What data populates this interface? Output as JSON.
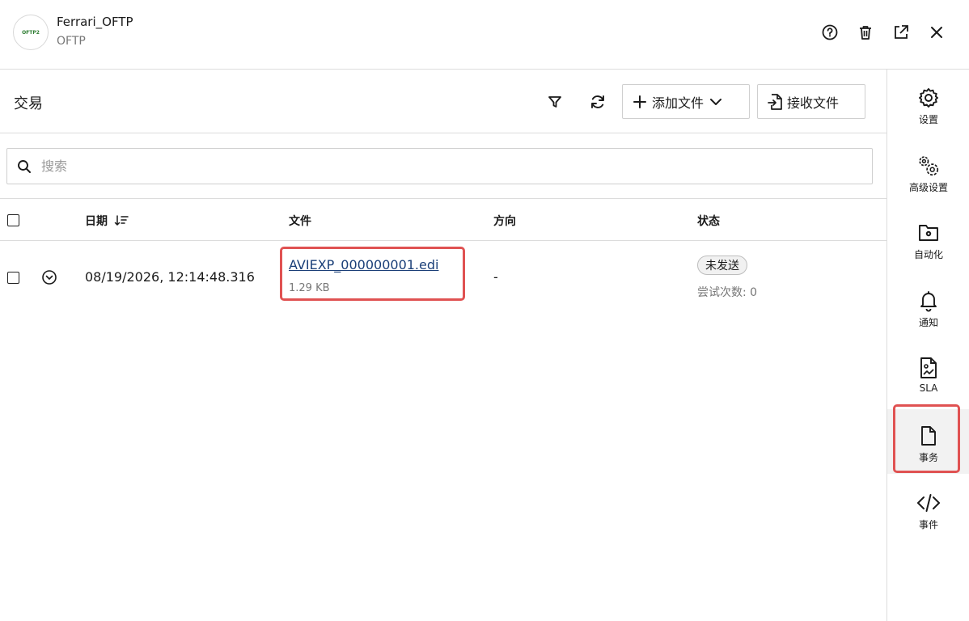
{
  "header": {
    "logo_text": "OFTP2",
    "title": "Ferrari_OFTP",
    "subtitle": "OFTP",
    "icons": [
      "help-icon",
      "trash-icon",
      "external-link-icon",
      "close-icon"
    ]
  },
  "toolbar": {
    "title": "交易",
    "add_file_label": "添加文件",
    "receive_file_label": "接收文件"
  },
  "search": {
    "placeholder": "搜索"
  },
  "table": {
    "columns": {
      "date": "日期",
      "file": "文件",
      "direction": "方向",
      "status": "状态"
    },
    "rows": [
      {
        "date": "08/19/2026, 12:14:48.316",
        "file_name": "AVIEXP_000000001.edi",
        "file_size": "1.29 KB",
        "direction": "-",
        "status": "未发送",
        "attempts": "尝试次数: 0"
      }
    ]
  },
  "sidenav": {
    "items": [
      {
        "label": "设置",
        "icon": "gear-icon"
      },
      {
        "label": "高级设置",
        "icon": "gears-icon"
      },
      {
        "label": "自动化",
        "icon": "folder-gear-icon"
      },
      {
        "label": "通知",
        "icon": "bell-icon"
      },
      {
        "label": "SLA",
        "icon": "sla-document-icon"
      },
      {
        "label": "事务",
        "icon": "document-icon"
      },
      {
        "label": "事件",
        "icon": "code-icon"
      }
    ],
    "active": "事务"
  },
  "colors": {
    "highlight": "#e05252",
    "link": "#1a3f78"
  }
}
